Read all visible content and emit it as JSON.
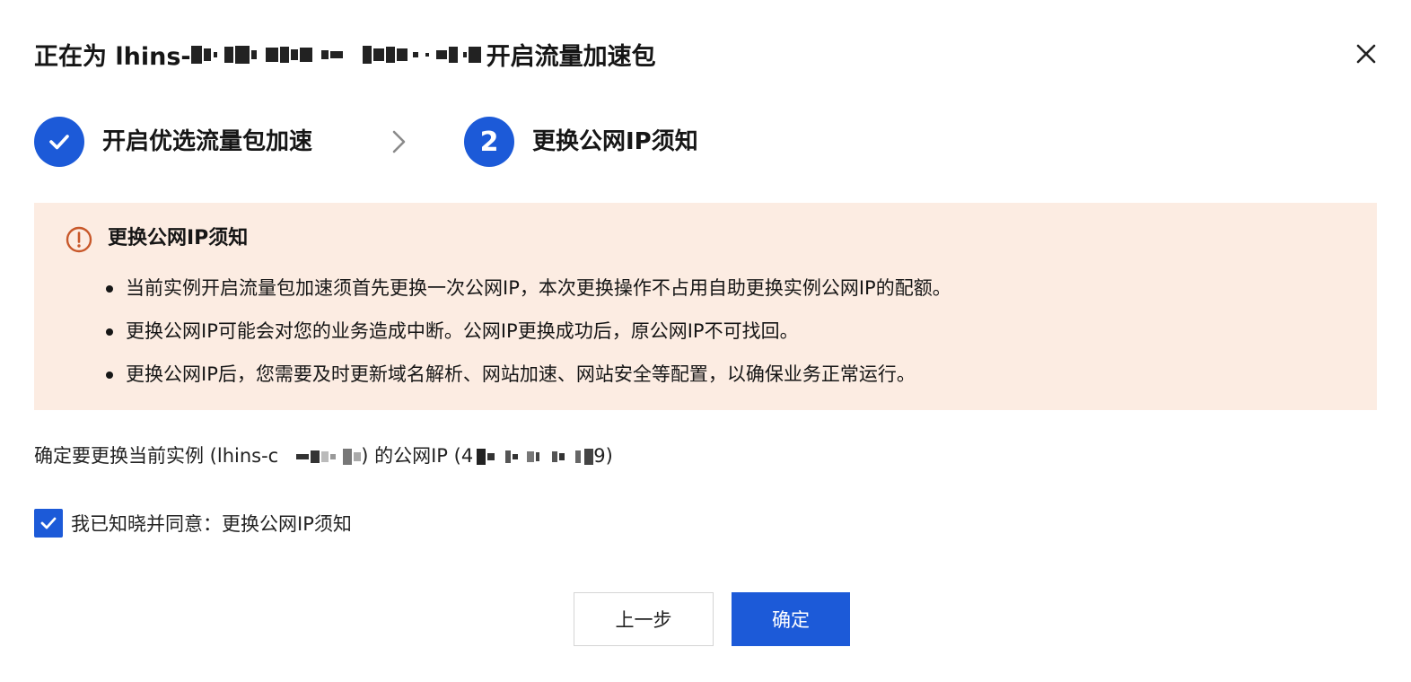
{
  "dialog": {
    "title_prefix": "正在为 lhins-",
    "title_suffix": "开启流量加速包",
    "close_icon": "close-icon"
  },
  "steps": [
    {
      "index": "1",
      "label": "开启优选流量包加速",
      "status": "done",
      "icon": "check-icon"
    },
    {
      "index": "2",
      "label": "更换公网IP须知",
      "status": "active"
    }
  ],
  "notice": {
    "icon": "warning-circle-icon",
    "title": "更换公网IP须知",
    "items": [
      "当前实例开启流量包加速须首先更换一次公网IP，本次更换操作不占用自助更换实例公网IP的配额。",
      "更换公网IP可能会对您的业务造成中断。公网IP更换成功后，原公网IP不可找回。",
      "更换公网IP后，您需要及时更新域名解析、网站加速、网站安全等配置，以确保业务正常运行。"
    ],
    "background_color": "#fcece2",
    "icon_color": "#c8582a"
  },
  "confirm": {
    "prefix": "确定要更换当前实例 (lhins-c",
    "middle": ") 的公网IP (4",
    "suffix": "9)"
  },
  "agreement": {
    "checked": true,
    "label": "我已知晓并同意：更换公网IP须知"
  },
  "buttons": {
    "prev_label": "上一步",
    "ok_label": "确定"
  },
  "colors": {
    "primary": "#1c5ad8"
  }
}
